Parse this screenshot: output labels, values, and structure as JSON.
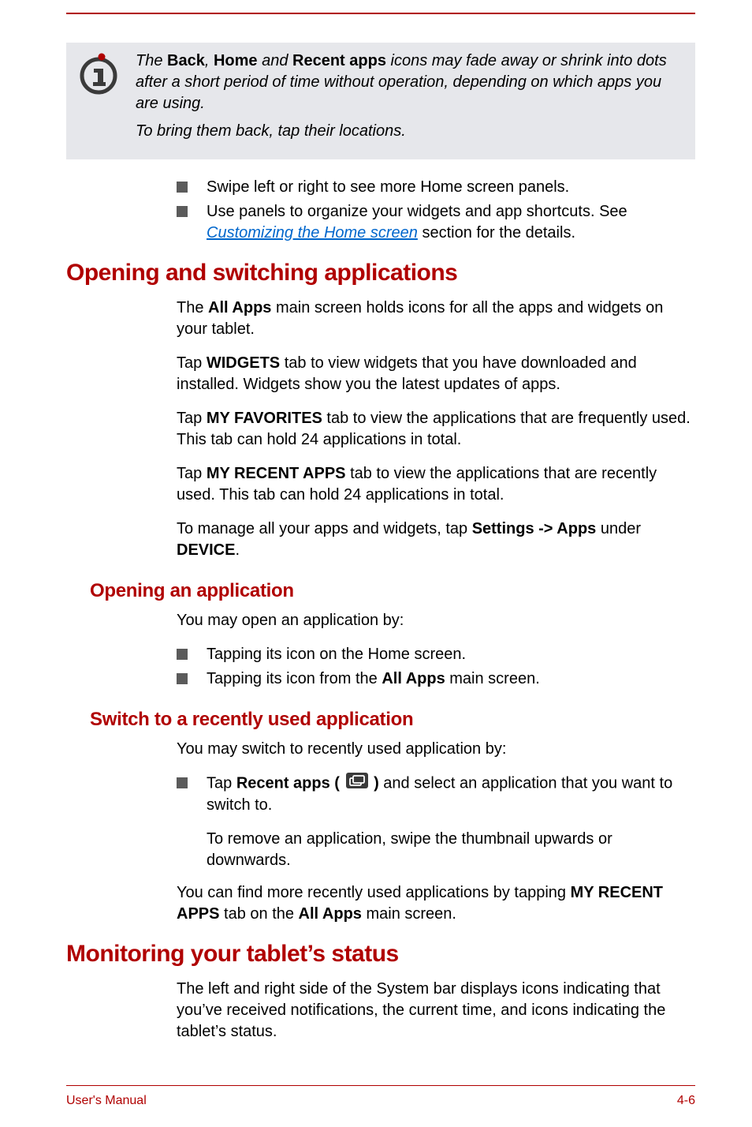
{
  "note": {
    "p1_pre": "The ",
    "p1_b1": "Back",
    "p1_mid1": ", ",
    "p1_b2": "Home",
    "p1_mid2": " and ",
    "p1_b3": "Recent apps",
    "p1_post": " icons may fade away or shrink into dots after a short period of time without operation, depending on which apps you are using.",
    "p2": "To bring them back, tap their locations."
  },
  "top_bullets": {
    "b1": "Swipe left or right to see more Home screen panels.",
    "b2_pre": "Use panels to organize your widgets and app shortcuts. See ",
    "b2_link": "Customizing the Home screen",
    "b2_post": " section for the details."
  },
  "s1": {
    "title": "Opening and switching applications",
    "p1_pre": "The ",
    "p1_b": "All Apps",
    "p1_post": " main screen holds icons for all the apps and widgets on your tablet.",
    "p2_pre": "Tap ",
    "p2_b": "WIDGETS",
    "p2_post": " tab to view widgets that you have downloaded and installed. Widgets show you the latest updates of apps.",
    "p3_pre": "Tap ",
    "p3_b": "MY FAVORITES",
    "p3_post": " tab to view the applications that are frequently used. This tab can hold 24 applications in total.",
    "p4_pre": "Tap ",
    "p4_b": "MY RECENT APPS",
    "p4_post": " tab to view the applications that are recently used. This tab can hold 24 applications in total.",
    "p5_pre": "To manage all your apps and widgets, tap ",
    "p5_b1": "Settings -> Apps",
    "p5_mid": " under ",
    "p5_b2": "DEVICE",
    "p5_post": "."
  },
  "s2": {
    "title": "Opening an application",
    "intro": "You may open an application by:",
    "b1": "Tapping its icon on the Home screen.",
    "b2_pre": "Tapping its icon from the ",
    "b2_b": "All Apps",
    "b2_post": " main screen."
  },
  "s3": {
    "title": "Switch to a recently used application",
    "intro": "You may switch to recently used application by:",
    "b1_pre": "Tap ",
    "b1_b": "Recent apps ( ",
    "b1_b_close": " )",
    "b1_post": " and select an application that you want to switch to.",
    "sub": "To remove an application, swipe the thumbnail upwards or downwards.",
    "p2_pre": "You can find more recently used applications by tapping ",
    "p2_b1": "MY RECENT APPS",
    "p2_mid": " tab on the ",
    "p2_b2": "All Apps",
    "p2_post": " main screen."
  },
  "s4": {
    "title": "Monitoring your tablet’s status",
    "p1": "The left and right side of the System bar displays icons indicating that you’ve received notifications, the current time, and icons indicating the tablet’s status."
  },
  "footer": {
    "left": "User's Manual",
    "right": "4-6"
  }
}
